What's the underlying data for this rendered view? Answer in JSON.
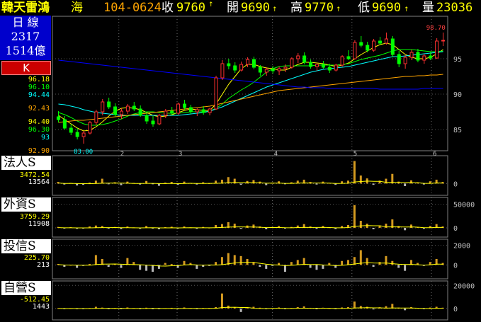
{
  "header": {
    "name": "韓天雷鴻",
    "sub": "海",
    "code": "104-0624",
    "close_label": "收",
    "close_value": "9760",
    "open_label": "開",
    "open_value": "9690",
    "high_label": "高",
    "high_value": "9770",
    "low_label": "低",
    "low_value": "9690",
    "volume_label": "量",
    "volume_value": "23036",
    "colors": {
      "name": "#ffff00",
      "code": "#ffa500",
      "value_up": "#ffff00",
      "label": "#ffffff"
    }
  },
  "sidebar": {
    "period": "日 線",
    "count": "2317",
    "amount": "1514億",
    "k_button": "K",
    "ma_values": [
      "96.18",
      "96.10",
      "94.44",
      "92.43",
      "94.40",
      "96.30",
      "93",
      "92.90"
    ],
    "panels": [
      {
        "title": "法人S",
        "v1": "3472.54",
        "v2": "13564"
      },
      {
        "title": "外資S",
        "v1": "3759.29",
        "v2": "11908"
      },
      {
        "title": "投信S",
        "v1": "225.70",
        "v2": "213"
      },
      {
        "title": "自營S",
        "v1": "-512.45",
        "v2": "1443"
      }
    ]
  },
  "chart_data": [
    {
      "type": "candlestick",
      "title": "",
      "x_tick_labels": [
        "2",
        "3",
        "4",
        "5",
        "6"
      ],
      "y_tick_labels": [
        "95",
        "90",
        "85"
      ],
      "ylim": [
        82,
        101
      ],
      "annotations": {
        "max_label": "98.70",
        "min_label": "83.00"
      },
      "ohlc": [
        [
          86.8,
          87.6,
          86.0,
          86.4
        ],
        [
          86.4,
          86.9,
          85.0,
          85.2
        ],
        [
          85.2,
          85.8,
          84.2,
          84.6
        ],
        [
          84.6,
          85.2,
          83.6,
          84.0
        ],
        [
          84.0,
          84.8,
          83.0,
          84.5
        ],
        [
          84.5,
          86.2,
          84.3,
          86.0
        ],
        [
          86.0,
          87.8,
          85.6,
          87.5
        ],
        [
          87.5,
          89.3,
          87.0,
          88.9
        ],
        [
          88.9,
          89.5,
          87.9,
          88.2
        ],
        [
          88.2,
          88.7,
          86.8,
          87.1
        ],
        [
          87.1,
          88.0,
          86.5,
          87.6
        ],
        [
          87.6,
          88.6,
          87.2,
          88.3
        ],
        [
          88.3,
          88.9,
          87.6,
          87.9
        ],
        [
          87.9,
          88.4,
          86.8,
          87.0
        ],
        [
          87.0,
          87.5,
          85.8,
          86.2
        ],
        [
          86.2,
          86.9,
          85.4,
          85.8
        ],
        [
          85.8,
          87.2,
          85.6,
          87.0
        ],
        [
          87.0,
          87.9,
          86.6,
          87.6
        ],
        [
          87.6,
          88.2,
          87.0,
          87.3
        ],
        [
          87.3,
          88.8,
          87.1,
          88.6
        ],
        [
          88.6,
          89.2,
          87.8,
          88.1
        ],
        [
          88.1,
          88.5,
          87.2,
          87.5
        ],
        [
          87.5,
          88.0,
          86.9,
          87.8
        ],
        [
          87.8,
          88.3,
          87.1,
          87.4
        ],
        [
          87.4,
          88.1,
          87.0,
          87.9
        ],
        [
          87.9,
          92.6,
          87.8,
          92.3
        ],
        [
          92.3,
          94.8,
          92.0,
          94.3
        ],
        [
          94.3,
          95.0,
          93.5,
          94.0
        ],
        [
          94.0,
          94.5,
          93.0,
          93.4
        ],
        [
          93.4,
          94.6,
          93.2,
          94.2
        ],
        [
          94.2,
          95.2,
          93.8,
          94.9
        ],
        [
          94.9,
          95.3,
          93.5,
          93.8
        ],
        [
          93.8,
          94.1,
          92.6,
          93.1
        ],
        [
          93.1,
          93.8,
          92.6,
          93.5
        ],
        [
          93.5,
          94.0,
          92.9,
          93.3
        ],
        [
          93.3,
          93.9,
          92.7,
          93.6
        ],
        [
          93.6,
          94.2,
          93.1,
          93.8
        ],
        [
          93.8,
          95.2,
          93.6,
          95.0
        ],
        [
          95.0,
          95.8,
          94.4,
          95.4
        ],
        [
          95.4,
          95.9,
          94.2,
          94.5
        ],
        [
          94.5,
          94.9,
          93.6,
          93.9
        ],
        [
          93.9,
          94.4,
          93.3,
          94.2
        ],
        [
          94.2,
          94.7,
          93.6,
          93.8
        ],
        [
          93.8,
          94.3,
          93.0,
          93.4
        ],
        [
          93.4,
          94.3,
          93.2,
          94.1
        ],
        [
          94.1,
          95.5,
          93.9,
          95.3
        ],
        [
          95.3,
          96.2,
          94.8,
          95.0
        ],
        [
          95.0,
          97.6,
          94.9,
          97.3
        ],
        [
          97.3,
          98.2,
          96.6,
          96.9
        ],
        [
          96.9,
          97.4,
          95.9,
          96.2
        ],
        [
          96.2,
          97.8,
          96.0,
          97.5
        ],
        [
          97.5,
          98.1,
          96.9,
          97.2
        ],
        [
          97.2,
          98.7,
          97.0,
          97.8
        ],
        [
          97.8,
          98.2,
          95.2,
          95.6
        ],
        [
          95.6,
          96.1,
          93.8,
          94.3
        ],
        [
          94.3,
          95.5,
          93.6,
          95.2
        ],
        [
          95.2,
          96.3,
          94.8,
          95.9
        ],
        [
          95.9,
          96.4,
          94.5,
          94.8
        ],
        [
          94.8,
          95.7,
          94.3,
          95.4
        ],
        [
          95.4,
          96.0,
          94.8,
          95.1
        ],
        [
          95.1,
          97.9,
          95.0,
          97.5
        ],
        [
          97.5,
          98.7,
          96.8,
          97.6
        ]
      ],
      "moving_averages": [
        {
          "name": "MA5",
          "color": "#ffff00",
          "values": [
            87.0,
            86.4,
            85.8,
            85.2,
            84.8,
            84.9,
            85.4,
            86.1,
            86.9,
            87.6,
            88.0,
            88.1,
            88.0,
            87.8,
            87.4,
            87.0,
            86.8,
            86.9,
            87.1,
            87.4,
            87.7,
            87.9,
            87.8,
            87.7,
            87.7,
            88.6,
            90.0,
            91.4,
            92.5,
            93.6,
            94.2,
            94.2,
            93.9,
            93.7,
            93.6,
            93.4,
            93.4,
            93.8,
            94.2,
            94.5,
            94.5,
            94.4,
            94.3,
            94.1,
            93.9,
            94.1,
            94.4,
            95.0,
            95.6,
            96.1,
            96.6,
            97.0,
            97.2,
            97.0,
            96.3,
            95.6,
            95.2,
            95.0,
            95.0,
            95.2,
            95.7,
            96.3
          ]
        },
        {
          "name": "MA10",
          "color": "#00ff00",
          "values": [
            87.4,
            87.1,
            86.7,
            86.2,
            85.8,
            85.6,
            85.6,
            85.7,
            85.9,
            86.2,
            86.5,
            86.9,
            87.2,
            87.4,
            87.5,
            87.5,
            87.4,
            87.3,
            87.3,
            87.3,
            87.4,
            87.5,
            87.5,
            87.5,
            87.6,
            88.0,
            88.6,
            89.4,
            90.0,
            90.6,
            91.1,
            91.7,
            92.4,
            93.1,
            93.6,
            93.9,
            94.0,
            94.0,
            94.0,
            94.0,
            94.0,
            94.1,
            94.1,
            94.1,
            94.1,
            94.2,
            94.3,
            94.6,
            94.9,
            95.1,
            95.3,
            95.5,
            95.8,
            96.1,
            96.3,
            96.3,
            96.3,
            96.2,
            96.1,
            96.0,
            96.0,
            96.1
          ]
        },
        {
          "name": "MA20",
          "color": "#00ffff",
          "values": [
            88.6,
            88.5,
            88.3,
            88.1,
            87.8,
            87.6,
            87.4,
            87.3,
            87.2,
            87.1,
            87.0,
            87.0,
            87.0,
            87.0,
            87.0,
            87.0,
            87.0,
            87.0,
            87.0,
            87.0,
            87.1,
            87.2,
            87.3,
            87.4,
            87.6,
            87.9,
            88.2,
            88.6,
            89.0,
            89.4,
            89.8,
            90.2,
            90.6,
            91.0,
            91.3,
            91.6,
            91.9,
            92.2,
            92.5,
            92.8,
            93.1,
            93.3,
            93.5,
            93.6,
            93.7,
            93.8,
            93.9,
            94.1,
            94.3,
            94.5,
            94.7,
            94.9,
            95.1,
            95.3,
            95.3,
            95.4,
            95.5,
            95.6,
            95.7,
            95.8,
            95.9,
            96.0
          ]
        },
        {
          "name": "MA60",
          "color": "#ffa500",
          "values": [
            86.0,
            86.1,
            86.2,
            86.3,
            86.3,
            86.4,
            86.5,
            86.6,
            86.7,
            86.8,
            86.9,
            87.0,
            87.1,
            87.2,
            87.3,
            87.4,
            87.5,
            87.6,
            87.7,
            87.8,
            87.9,
            88.0,
            88.1,
            88.2,
            88.3,
            88.5,
            88.7,
            88.9,
            89.1,
            89.3,
            89.5,
            89.7,
            89.9,
            90.1,
            90.3,
            90.5,
            90.6,
            90.7,
            90.8,
            90.9,
            91.0,
            91.1,
            91.2,
            91.3,
            91.4,
            91.5,
            91.6,
            91.7,
            91.8,
            91.9,
            92.0,
            92.1,
            92.2,
            92.3,
            92.4,
            92.5,
            92.5,
            92.6,
            92.6,
            92.7,
            92.7,
            92.8
          ]
        },
        {
          "name": "MA120",
          "color": "#0000ff",
          "values": [
            94.8,
            94.7,
            94.6,
            94.5,
            94.4,
            94.3,
            94.2,
            94.1,
            94.0,
            93.9,
            93.8,
            93.7,
            93.6,
            93.5,
            93.4,
            93.3,
            93.2,
            93.1,
            93.0,
            92.9,
            92.8,
            92.7,
            92.6,
            92.5,
            92.4,
            92.3,
            92.2,
            92.1,
            92.0,
            91.9,
            91.8,
            91.7,
            91.6,
            91.5,
            91.4,
            91.3,
            91.2,
            91.1,
            91.0,
            91.0,
            90.9,
            90.9,
            90.9,
            90.8,
            90.8,
            90.8,
            90.8,
            90.8,
            90.8,
            90.8,
            90.8,
            90.7,
            90.7,
            90.7,
            90.7,
            90.7,
            90.7,
            90.7,
            90.8,
            90.8,
            90.8,
            90.8
          ]
        }
      ]
    },
    {
      "type": "bar",
      "title": "法人S",
      "y_tick_labels": [
        "0"
      ],
      "ylim": [
        -3000,
        8000
      ],
      "values": [
        500,
        -300,
        200,
        -600,
        -400,
        300,
        900,
        1500,
        -200,
        400,
        -500,
        600,
        200,
        -300,
        800,
        -200,
        -700,
        300,
        500,
        -400,
        600,
        200,
        -300,
        400,
        100,
        900,
        1200,
        2000,
        1500,
        -400,
        800,
        1100,
        600,
        -500,
        300,
        700,
        -200,
        400,
        900,
        1200,
        500,
        -300,
        600,
        200,
        -400,
        700,
        900,
        7000,
        2500,
        1600,
        -400,
        900,
        1500,
        3000,
        600,
        -800,
        1000,
        400,
        -300,
        700,
        1200,
        500
      ]
    },
    {
      "type": "bar",
      "title": "外資S",
      "y_tick_labels": [
        "50000",
        "0"
      ],
      "ylim": [
        -15000,
        60000
      ],
      "values": [
        2000,
        -1000,
        1500,
        -2000,
        -1500,
        3000,
        5000,
        4000,
        -1000,
        2000,
        -2500,
        3000,
        1000,
        -2000,
        4000,
        -1000,
        -3000,
        1500,
        2500,
        -1500,
        3000,
        1000,
        -2000,
        2000,
        500,
        6000,
        8000,
        12000,
        9000,
        -2000,
        5000,
        7000,
        3000,
        -3000,
        2000,
        4000,
        -1000,
        2000,
        5000,
        8000,
        3000,
        -2000,
        4000,
        1000,
        -2500,
        4000,
        6000,
        48000,
        15000,
        9000,
        -3000,
        5000,
        9000,
        18000,
        4000,
        -5000,
        7000,
        2000,
        -2000,
        4000,
        8000,
        3000
      ]
    },
    {
      "type": "bar",
      "title": "投信S",
      "y_tick_labels": [
        "2000",
        "0"
      ],
      "ylim": [
        -1200,
        2400
      ],
      "values": [
        100,
        -200,
        0,
        -300,
        -100,
        100,
        1000,
        600,
        -200,
        100,
        -300,
        700,
        300,
        -500,
        -600,
        -700,
        -400,
        200,
        100,
        -300,
        400,
        200,
        -400,
        -200,
        -100,
        300,
        800,
        1200,
        1000,
        900,
        600,
        300,
        -200,
        -400,
        -100,
        200,
        -700,
        300,
        500,
        700,
        -300,
        -500,
        -400,
        200,
        -300,
        400,
        500,
        800,
        1500,
        700,
        -200,
        300,
        900,
        400,
        -300,
        -600,
        500,
        200,
        -100,
        300,
        600,
        200
      ]
    },
    {
      "type": "bar",
      "title": "自營S",
      "y_tick_labels": [
        "20000",
        "0"
      ],
      "ylim": [
        -8000,
        22000
      ],
      "values": [
        300,
        -500,
        200,
        -300,
        -200,
        400,
        1500,
        800,
        -400,
        300,
        -600,
        900,
        400,
        -300,
        700,
        -200,
        -500,
        300,
        600,
        -400,
        900,
        300,
        -200,
        500,
        200,
        1200,
        13000,
        2500,
        1000,
        -3000,
        800,
        1500,
        700,
        -600,
        400,
        900,
        -300,
        500,
        1200,
        1800,
        600,
        -400,
        700,
        300,
        -500,
        900,
        1200,
        6000,
        2200,
        1500,
        -800,
        1100,
        2000,
        4000,
        800,
        -1500,
        1200,
        500,
        -400,
        800,
        1500,
        700
      ]
    }
  ]
}
